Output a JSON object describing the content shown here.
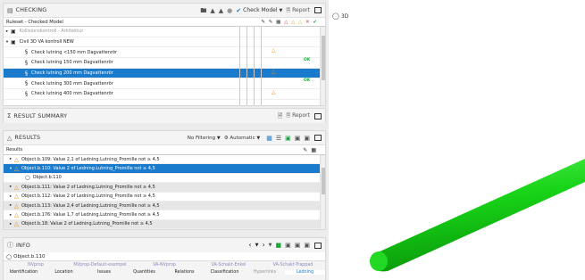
{
  "checking": {
    "title": "CHECKING",
    "check_model": "Check Model",
    "report": "Report",
    "ruleset": "Ruleset - Checked Model",
    "rows": [
      {
        "label": "Kollisionskontroll - Arkitektur",
        "indent": 4,
        "expander": "▸",
        "icon": "▣",
        "dim": true,
        "status": ""
      },
      {
        "label": "Civil 3D VA kontroll NEW",
        "indent": 4,
        "expander": "▾",
        "icon": "▣",
        "status": ""
      },
      {
        "label": "Check lutning <150 mm Dagvattenrör",
        "indent": 20,
        "icon": "§",
        "status": "warn"
      },
      {
        "label": "Check lutning 150 mm Dagvattenrör",
        "indent": 20,
        "icon": "§",
        "status": "ok"
      },
      {
        "label": "Check lutning 200 mm Dagvattenrör",
        "indent": 20,
        "icon": "§",
        "status": "warn",
        "sel": true
      },
      {
        "label": "Check lutning 300 mm Dagvattenrör",
        "indent": 20,
        "icon": "§",
        "status": "ok"
      },
      {
        "label": "Check lutning 400 mm Dagvattenrör",
        "indent": 20,
        "icon": "§",
        "status": "warn"
      }
    ]
  },
  "summary": {
    "title": "RESULT SUMMARY",
    "report": "Report"
  },
  "results": {
    "title": "RESULTS",
    "filtering": "No Filtering",
    "automatic": "Automatic",
    "header": "Results",
    "rows": [
      {
        "label": "Object.b.109: Value 2,1 of Ledning.Lutning_Promille not ≥ 4,5",
        "indent": 14,
        "exp": "▸",
        "warn": true
      },
      {
        "label": "Object.b.110: Value 2 of Ledning.Lutning_Promille not ≥ 4,5",
        "indent": 14,
        "exp": "▾",
        "warn": true,
        "sel": true
      },
      {
        "label": "Object.b.110",
        "indent": 26,
        "exp": "",
        "warn": false,
        "circle": true
      },
      {
        "label": "Object.b.111: Value 2 of Ledning.Lutning_Promille not ≥ 4,5",
        "indent": 14,
        "exp": "▸",
        "warn": true,
        "alt": true
      },
      {
        "label": "Object.b.112: Value 2 of Ledning.Lutning_Promille not ≥ 4,5",
        "indent": 14,
        "exp": "▸",
        "warn": true
      },
      {
        "label": "Object.b.113: Value 2,4 of Ledning.Lutning_Promille not ≥ 4,5",
        "indent": 14,
        "exp": "▸",
        "warn": true,
        "alt": true
      },
      {
        "label": "Object.b.176: Value 1,7 of Ledning.Lutning_Promille not ≥ 4,5",
        "indent": 14,
        "exp": "▸",
        "warn": true
      },
      {
        "label": "Object.b.18: Value 2 of Ledning.Lutning_Promille not ≥ 4,5",
        "indent": 14,
        "exp": "▸",
        "warn": true,
        "alt": true
      }
    ]
  },
  "info": {
    "title": "INFO",
    "object": "Object.b.110",
    "tabs_top": [
      "NVprop",
      "NVprop-Default-exempel",
      "VA-NVprop",
      "VA-Schakt-Enkel",
      "VA-Schakt-Trappad"
    ],
    "tabs_bottom": [
      "Identification",
      "Location",
      "Issues",
      "Quantities",
      "Relations",
      "Classification",
      "Hyperlinks",
      "Ledning"
    ]
  },
  "view3d": {
    "label": "3D"
  },
  "colors": {
    "selection": "#1a7acc",
    "warning": "#f08a00",
    "ok": "#1aa83a",
    "pipe": "#18d418"
  }
}
